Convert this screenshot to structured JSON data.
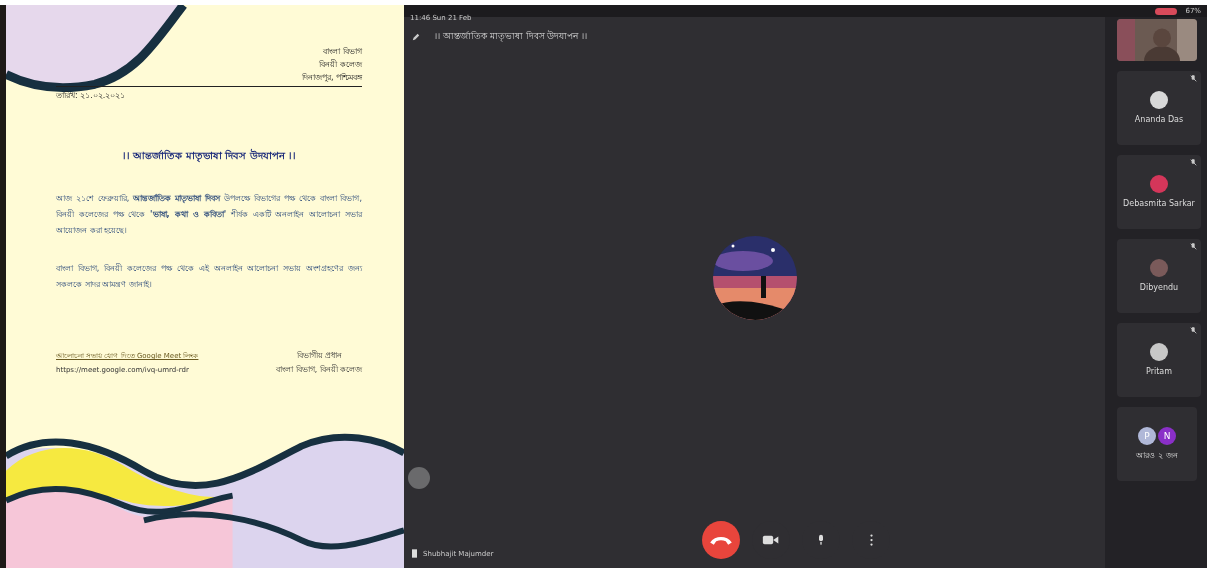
{
  "status_bar": {
    "time": "11:46  Sun 21 Feb",
    "battery": "67%"
  },
  "document": {
    "address": [
      "বাংলা বিভাগ",
      "বিনয়ী কলেজ",
      "দিনাজপুর, পশ্চিমবঙ্গ"
    ],
    "date": "তারিখ: ২১.০২.২০২১",
    "heading": "।। আন্তর্জাতিক মাতৃভাষা দিবস উদযাপন ।।",
    "paragraphs": [
      "আজ ২১শে ফেব্রুয়ারি, **আন্তর্জাতিক মাতৃভাষা দিবস** উপলক্ষে বিভাগের পক্ষ থেকে বাংলা বিভাগ, বিনয়ী কলেজের পক্ষ থেকে **'ভাষা, কথা ও কবিতা'** শীর্ষক একটি অনলাইন আলোচনা সভার আয়োজন করা হয়েছে।",
      "বাংলা বিভাগ, বিনয়ী কলেজের পক্ষ থেকে এই অনলাইন আলোচনা সভায় অংশগ্রহণের জন্য সকলকে সাদর আমন্ত্রণ জানাই।"
    ],
    "footer_link": "আলোচনা সভায় যোগ দিতে Google Meet লিংক",
    "footer_url": "https://meet.google.com/ivq-umrd-rdr",
    "signature": [
      "বিভাগীয় প্রধান",
      "বাংলা বিভাগ, বিনয়ী কলেজ"
    ]
  },
  "meeting": {
    "title": "।। আন্তর্জাতিক মাতৃভাষা দিবস উদযাপন ।।",
    "presenter": "Shubhajit Majumder",
    "participants": [
      {
        "kind": "video"
      },
      {
        "kind": "avatar",
        "name": "Ananda Das",
        "muted": true,
        "color": "#d8d8d8"
      },
      {
        "kind": "avatar",
        "name": "Debasmita Sarkar",
        "muted": true,
        "color": "#d4365a"
      },
      {
        "kind": "avatar",
        "name": "Dibyendu",
        "muted": true,
        "color": "#7a5a5a"
      },
      {
        "kind": "avatar",
        "name": "Pritam",
        "muted": true,
        "color": "#c8c8c8"
      },
      {
        "kind": "group",
        "name": "আরও ২ জন",
        "initials": [
          "P",
          "N"
        ]
      }
    ]
  }
}
